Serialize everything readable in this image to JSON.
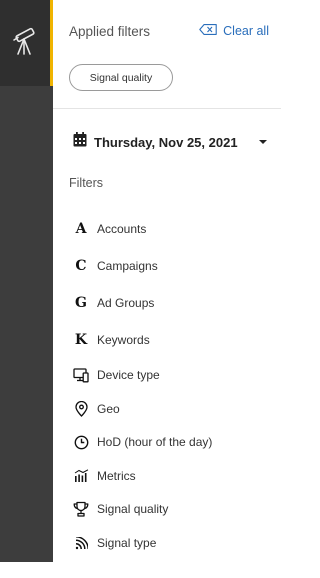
{
  "header": {
    "title": "Applied filters",
    "clear_all": "Clear all"
  },
  "applied": [
    {
      "label": "Signal quality"
    }
  ],
  "date": {
    "label": "Thursday, Nov 25, 2021"
  },
  "filters_title": "Filters",
  "filters": [
    {
      "label": "Accounts",
      "icon": "letter",
      "glyph": "A"
    },
    {
      "label": "Campaigns",
      "icon": "letter",
      "glyph": "C"
    },
    {
      "label": "Ad Groups",
      "icon": "letter",
      "glyph": "G"
    },
    {
      "label": "Keywords",
      "icon": "letter",
      "glyph": "K"
    },
    {
      "label": "Device type",
      "icon": "devices-icon"
    },
    {
      "label": "Geo",
      "icon": "location-pin-icon"
    },
    {
      "label": "HoD (hour of the day)",
      "icon": "clock-icon"
    },
    {
      "label": "Metrics",
      "icon": "bar-chart-icon"
    },
    {
      "label": "Signal quality",
      "icon": "trophy-icon"
    },
    {
      "label": "Signal type",
      "icon": "signal-icon"
    }
  ],
  "colors": {
    "rail": "#3d3d3d",
    "rail_active_accent": "#f0b400",
    "link": "#2a6ebb"
  }
}
